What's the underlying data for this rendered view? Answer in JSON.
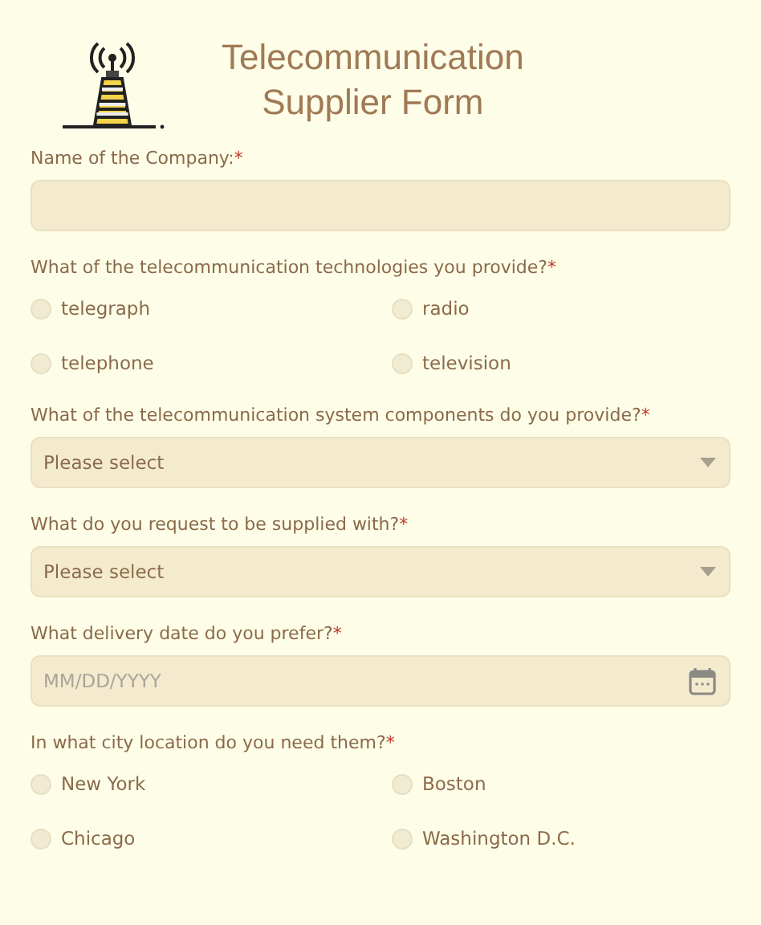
{
  "title": [
    "Telecommunication",
    "Supplier Form"
  ],
  "fields": [
    {
      "kind": "text",
      "label": "Name of the Company:",
      "mark": "*"
    },
    {
      "kind": "radio",
      "label": "What of the telecommunication technologies you provide?",
      "mark": "*",
      "options": [
        {
          "label": "telegraph",
          "selected": false
        },
        {
          "label": "radio",
          "selected": false
        },
        {
          "label": "telephone",
          "selected": false
        },
        {
          "label": "television",
          "selected": false
        }
      ]
    },
    {
      "kind": "select",
      "label": "What of the telecommunication system components do you provide?",
      "mark": "*",
      "placeholder": "Please select"
    },
    {
      "kind": "select",
      "label": "What do you request to be supplied with?",
      "mark": "*",
      "placeholder": "Please select"
    },
    {
      "kind": "date",
      "label": "What delivery date do you prefer?",
      "mark": "*",
      "placeholder": "MM/DD/YYYY"
    },
    {
      "kind": "radio",
      "label": "In what city location do you need them?",
      "mark": "*",
      "options": [
        {
          "label": "New York",
          "selected": false
        },
        {
          "label": "Boston",
          "selected": false
        },
        {
          "label": "Chicago",
          "selected": false
        },
        {
          "label": "Washington D.C.",
          "selected": false
        }
      ]
    }
  ]
}
